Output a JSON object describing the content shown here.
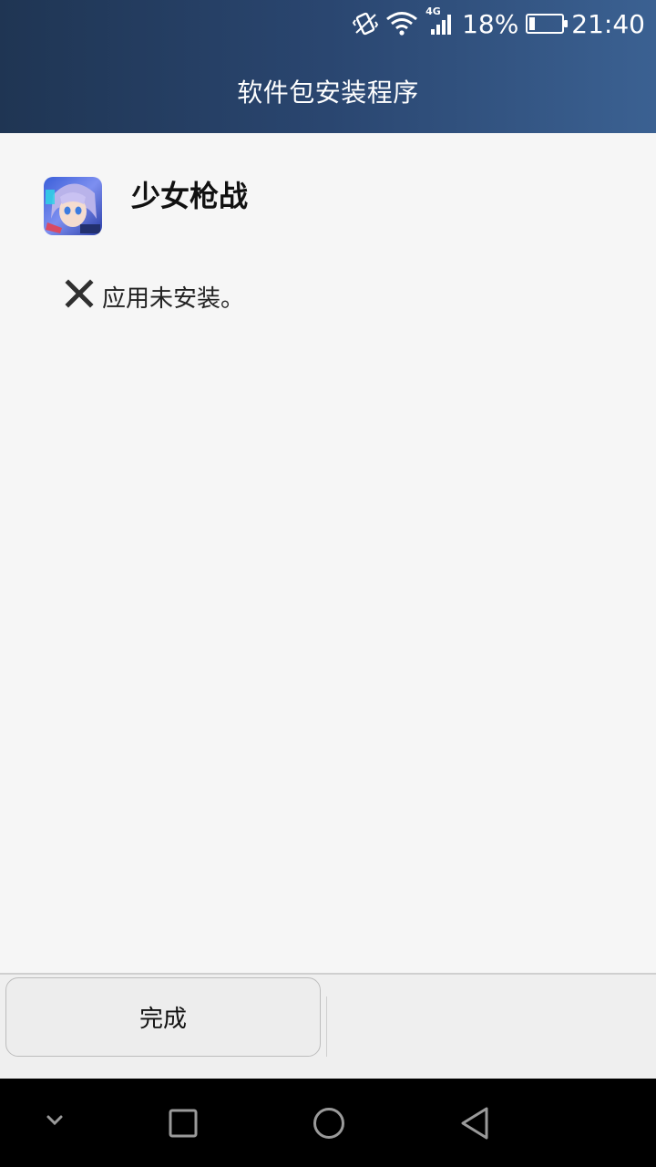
{
  "status_bar": {
    "time": "21:40",
    "battery_percent": "18%",
    "battery_level": 0.18,
    "network_type": "4G",
    "icons": [
      "vibrate-icon",
      "wifi-icon",
      "cell-signal-icon",
      "battery-icon"
    ]
  },
  "header": {
    "title": "软件包安装程序",
    "gradient_colors": [
      "#1f3553",
      "#3b6192"
    ]
  },
  "app": {
    "name": "少女枪战",
    "icon": "app-icon"
  },
  "result": {
    "icon": "close-x-icon",
    "message": "应用未安装。"
  },
  "actions": {
    "done_label": "完成"
  },
  "nav": {
    "icons": [
      "chevron-down-icon",
      "recent-apps-icon",
      "home-icon",
      "back-icon"
    ]
  }
}
